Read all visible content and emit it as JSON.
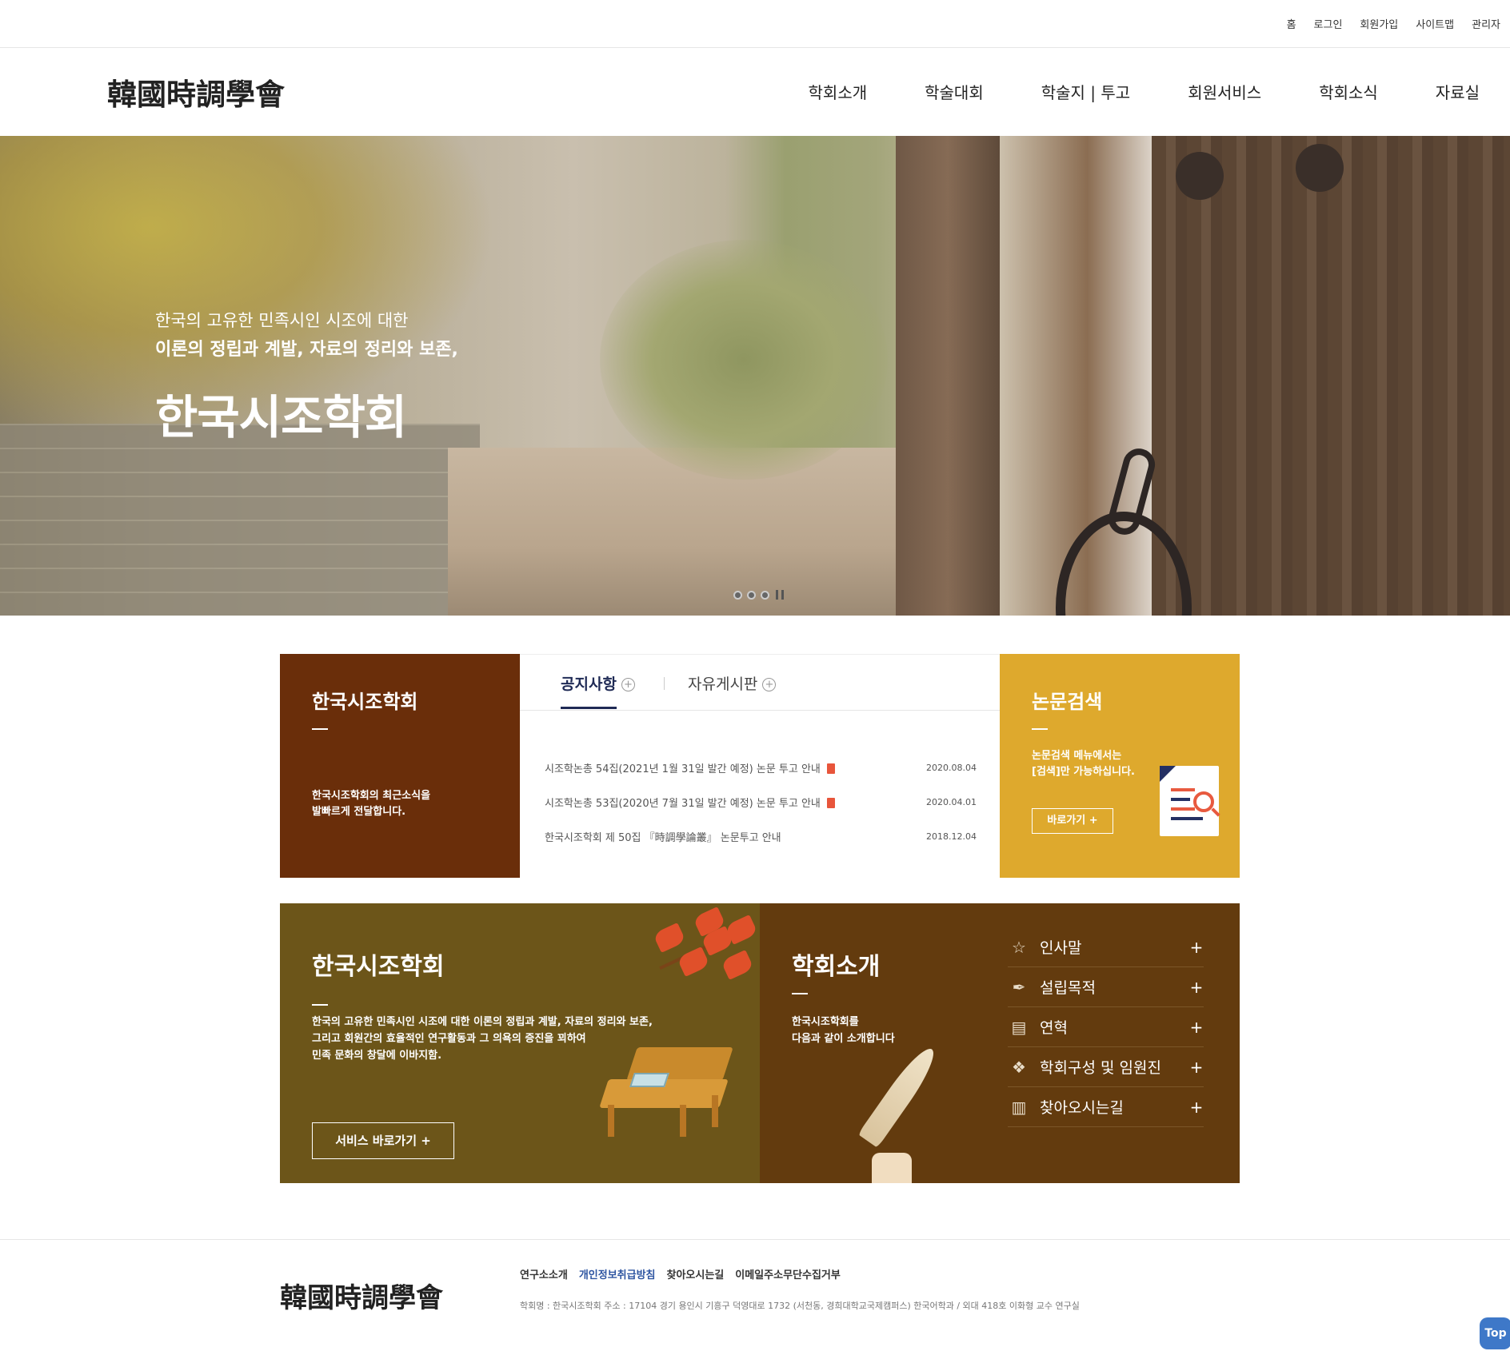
{
  "utility_nav": [
    "홈",
    "로그인",
    "회원가입",
    "사이트맵",
    "관리자"
  ],
  "logo": "韓國時調學會",
  "main_nav": [
    "학회소개",
    "학술대회",
    "학술지 | 투고",
    "회원서비스",
    "학회소식",
    "자료실"
  ],
  "hero": {
    "line1": "한국의 고유한 민족시인 시조에 대한",
    "line2": "이론의 정립과 계발, 자료의 정리와 보존,",
    "title": "한국시조학회",
    "slide_count": 3
  },
  "news_card": {
    "title": "한국시조학회",
    "desc_line1": "한국시조학회의 최근소식을",
    "desc_line2": "발빠르게 전달합니다."
  },
  "board": {
    "tabs": [
      "공지사항",
      "자유게시판"
    ],
    "active_tab": 0,
    "plus_glyph": "+",
    "rows": [
      {
        "title": "시조학논총 54집(2021년 1월 31일 발간 예정) 논문 투고 안내",
        "date": "2020.08.04",
        "has_file": true
      },
      {
        "title": "시조학논총 53집(2020년 7월 31일 발간 예정) 논문 투고 안내",
        "date": "2020.04.01",
        "has_file": true
      },
      {
        "title": "한국시조학회 제 50집 『時調學論叢』 논문투고 안내",
        "date": "2018.12.04",
        "has_file": false
      }
    ]
  },
  "search_card": {
    "title": "논문검색",
    "desc_line1": "논문검색 메뉴에서는",
    "desc_line2": "[검색]만 가능하십니다.",
    "button": "바로가기 +"
  },
  "society_card": {
    "title": "한국시조학회",
    "desc_line1": "한국의 고유한 민족시인 시조에 대한 이론의 정립과 계발, 자료의 정리와 보존,",
    "desc_line2": "그리고 회원간의 효율적인 연구활동과 그 의욕의 증진을 꾀하여",
    "desc_line3": "민족 문화의 창달에 이바지함.",
    "button": "서비스 바로가기 +"
  },
  "intro_card": {
    "title": "학회소개",
    "desc_line1": "한국시조학회를",
    "desc_line2": "다음과 같이 소개합니다",
    "items": [
      {
        "label": "인사말",
        "icon": "star-icon",
        "glyph": "☆"
      },
      {
        "label": "설립목적",
        "icon": "pen-nib-icon",
        "glyph": "✒"
      },
      {
        "label": "연혁",
        "icon": "list-document-icon",
        "glyph": "▤"
      },
      {
        "label": "학회구성 및 임원진",
        "icon": "handshake-icon",
        "glyph": "❖"
      },
      {
        "label": "찾아오시는길",
        "icon": "building-icon",
        "glyph": "▥"
      }
    ],
    "plus_glyph": "+"
  },
  "footer": {
    "logo": "韓國時調學會",
    "links": [
      "연구소소개",
      "개인정보취급방침",
      "찾아오시는길",
      "이메일주소무단수집거부"
    ],
    "highlight_link": 1,
    "address": "학회명 : 한국시조학회      주소 : 17104 경기 용인시 기흥구 덕영대로 1732 (서천동, 경희대학교국제캠퍼스) 한국어학과 / 외대 418호 이화형 교수 연구실"
  },
  "top_button": "Top",
  "colors": {
    "brown": "#6a2e0a",
    "gold": "#dea92d",
    "olive": "#6c5519",
    "dark_brown": "#633b0e",
    "navy": "#1f2a55",
    "link_blue": "#2f56a2",
    "top_button": "#3e78c8"
  }
}
